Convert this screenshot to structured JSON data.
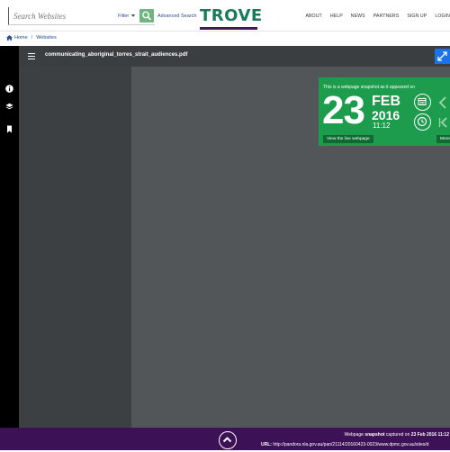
{
  "header": {
    "search": {
      "placeholder": "Search Websites"
    },
    "filter_label": "Filter",
    "advanced_search_label": "Advanced Search",
    "logo_text": "TROVE",
    "nav": [
      "ABOUT",
      "HELP",
      "NEWS",
      "PARTNERS",
      "SIGN UP",
      "LOGIN"
    ]
  },
  "breadcrumb": {
    "home": "Home",
    "section": "Websites"
  },
  "viewer": {
    "filename": "communicating_aboriginal_torres_strait_audiences.pdf"
  },
  "snapshot": {
    "note": "This is a webpage snapshot as it appeared on",
    "day": "23",
    "month": "FEB",
    "year": "2016",
    "time": "11:12",
    "view_live_label": "View the live webpage",
    "more_label": "More s"
  },
  "footer": {
    "captured_prefix": "Webpage ",
    "captured_bold": "snapshot",
    "captured_mid": " captured on ",
    "captured_date": "23 Feb 2016 11:12",
    "url_label": "URL:",
    "url_value": " http://pandora.nla.gov.au/pan/21114/20160423-0023/www.dpmc.gov.au/sites/d"
  },
  "colors": {
    "brand_green": "#1b7a5a",
    "brand_purple": "#3c1155",
    "snapshot_green": "#1e9c4e",
    "link_blue": "#2a4b8d",
    "expand_blue": "#1a73e8"
  }
}
